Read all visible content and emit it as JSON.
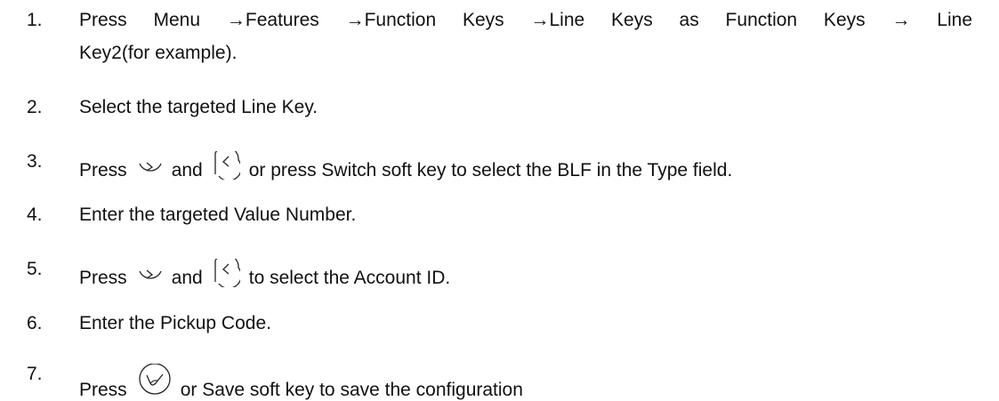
{
  "steps": [
    {
      "number": "1.",
      "line1": "Press Menu →Features →Function Keys →Line Keys as Function Keys → Line",
      "line2": "Key2(for example)."
    },
    {
      "number": "2.",
      "text": "Select the targeted Line Key."
    },
    {
      "number": "3.",
      "pre": "Press",
      "mid": "and",
      "post": "or press Switch soft key to select the BLF in the Type  field.",
      "icons": [
        "right-navigation-key-icon",
        "left-navigation-key-icon"
      ]
    },
    {
      "number": "4.",
      "text": "Enter the targeted Value Number."
    },
    {
      "number": "5.",
      "pre": "Press",
      "mid": "and",
      "post": "to select the Account ID.",
      "icons": [
        "right-navigation-key-icon",
        "left-navigation-key-icon"
      ]
    },
    {
      "number": "6.",
      "text": "Enter the Pickup Code."
    },
    {
      "number": "7.",
      "pre": "Press",
      "post": "or Save soft key to save the  configuration",
      "icons": [
        "ok-key-icon"
      ]
    }
  ]
}
